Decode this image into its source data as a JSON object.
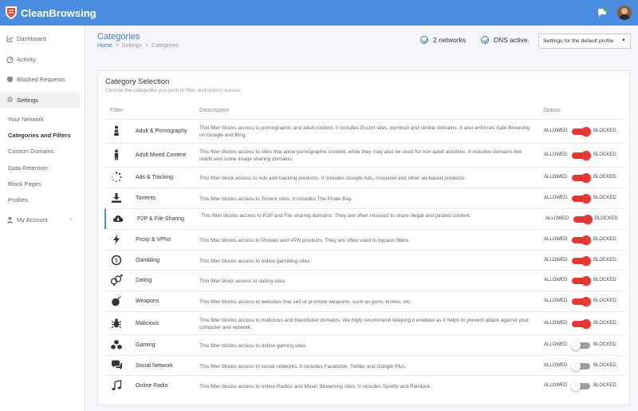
{
  "app": {
    "brand": "CleanBrowsing"
  },
  "sidebar": {
    "items": [
      {
        "label": "Dashboard",
        "icon": "chart-icon"
      },
      {
        "label": "Activity",
        "icon": "speedometer-icon"
      },
      {
        "label": "Blocked Requests",
        "icon": "shield-icon"
      },
      {
        "label": "Settings",
        "icon": "gear-icon"
      }
    ],
    "sub_items": [
      {
        "label": "Your Network"
      },
      {
        "label": "Categories and Filters"
      },
      {
        "label": "Custom Domains"
      },
      {
        "label": "Data Retention"
      },
      {
        "label": "Block Pages"
      },
      {
        "label": "Profiles"
      }
    ],
    "account": {
      "label": "My Account",
      "icon": "user-icon"
    }
  },
  "header": {
    "title": "Categories",
    "breadcrumb": [
      "Home",
      "Settings",
      "Categories"
    ],
    "networks": "2 networks",
    "dns": "DNS active.",
    "profile_select": "Settings for the default profile"
  },
  "card": {
    "title": "Category Selection",
    "subtitle": "Choose the categories you wish to filter and restrict access.",
    "columns": {
      "filter": "Filter",
      "description": "Description",
      "status": "Status"
    },
    "allowed_label": "ALLOWED",
    "blocked_label": "BLOCKED",
    "rows": [
      {
        "name": "Adult & Pornography",
        "icon": "adult-icon",
        "blocked": true,
        "description": "This filter blocks access to pornographic and adult content. It includes Escort sites, pornhub and similar domains. It also enforces Safe Browsing on Google and Bing."
      },
      {
        "name": "Adult Mixed Content",
        "icon": "person-icon",
        "blocked": true,
        "description": "This filter blocks access to sites that allow pornographic content, while they may also be used for non-adult activities. It includes domains like reddit and some image sharing domains."
      },
      {
        "name": "Ads & Tracking",
        "icon": "tracking-icon",
        "blocked": true,
        "description": "This filter block access to Ads and tracking products. It includes Google Ads, mixpanel and other ad-based products."
      },
      {
        "name": "Torrents",
        "icon": "download-icon",
        "blocked": true,
        "description": "This filter blocks access to Torrent sites. It includes The Pirate Bay."
      },
      {
        "name": "P2P & File Sharing",
        "icon": "cloud-download-icon",
        "blocked": true,
        "description": "This filter blocks access to P2P and File sharing domains. They are often misused to share illegal and pirated content."
      },
      {
        "name": "Proxy & VPNs",
        "icon": "bolt-icon",
        "blocked": true,
        "description": "This filter blocks access to Proxies and VPN products. They are often used to bypass filters."
      },
      {
        "name": "Gambling",
        "icon": "gambling-icon",
        "blocked": true,
        "description": "This filter blocks access to online gambling sites."
      },
      {
        "name": "Dating",
        "icon": "dating-icon",
        "blocked": true,
        "description": "This filter block access to dating sites."
      },
      {
        "name": "Weapons",
        "icon": "bomb-icon",
        "blocked": true,
        "description": "This filter blocks access to websites that sell or promote weapons, such as guns, knives, etc."
      },
      {
        "name": "Malicious",
        "icon": "bug-icon",
        "blocked": true,
        "description": "This filter blocks access to malicious and blacklisted domains. We higly recommend keeping it enabled as it helps to prevent attack against your computer and network."
      },
      {
        "name": "Gaming",
        "icon": "cubes-icon",
        "blocked": false,
        "description": "This filter blocks access to online gaming sites."
      },
      {
        "name": "Social Network",
        "icon": "comments-icon",
        "blocked": false,
        "description": "This filter blocks access to social networks. It includes Facebook, Twitter and Google Plus."
      },
      {
        "name": "Online Radio",
        "icon": "music-icon",
        "blocked": false,
        "description": "This filter blocks access to online Radios and Music Streaming sites. It includes Spotify and Pandora."
      }
    ]
  },
  "colors": {
    "topbar": "#4a8de0",
    "accent": "#3b7cd0",
    "toggle_on": "#e53935",
    "toggle_off": "#9e9e9e"
  }
}
